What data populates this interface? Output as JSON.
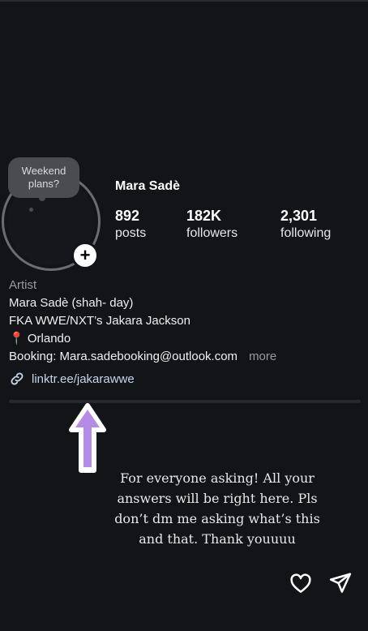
{
  "profile": {
    "name": "Mara Sadè",
    "note": "Weekend plans?",
    "stats": [
      {
        "value": "892",
        "label": "posts"
      },
      {
        "value": "182K",
        "label": "followers"
      },
      {
        "value": "2,301",
        "label": "following"
      }
    ]
  },
  "bio": {
    "category": "Artist",
    "line1": "Mara Sadè (shah- day)",
    "line2": "FKA WWE/NXT’s Jakara Jackson",
    "location_pin": "📍",
    "location": "Orlando",
    "booking": "Booking: Mara.sadebooking@outlook.com",
    "more_label": "more",
    "link": "linktr.ee/jakarawwe"
  },
  "story": {
    "caption": "For everyone asking! All your answers will be right here. Pls don’t dm me asking what’s this and that. Thank youuuu",
    "arrow_color": "#b58be8"
  },
  "icons": {
    "like": "heart-icon",
    "share": "send-icon",
    "link": "link-icon",
    "add": "plus-icon"
  }
}
